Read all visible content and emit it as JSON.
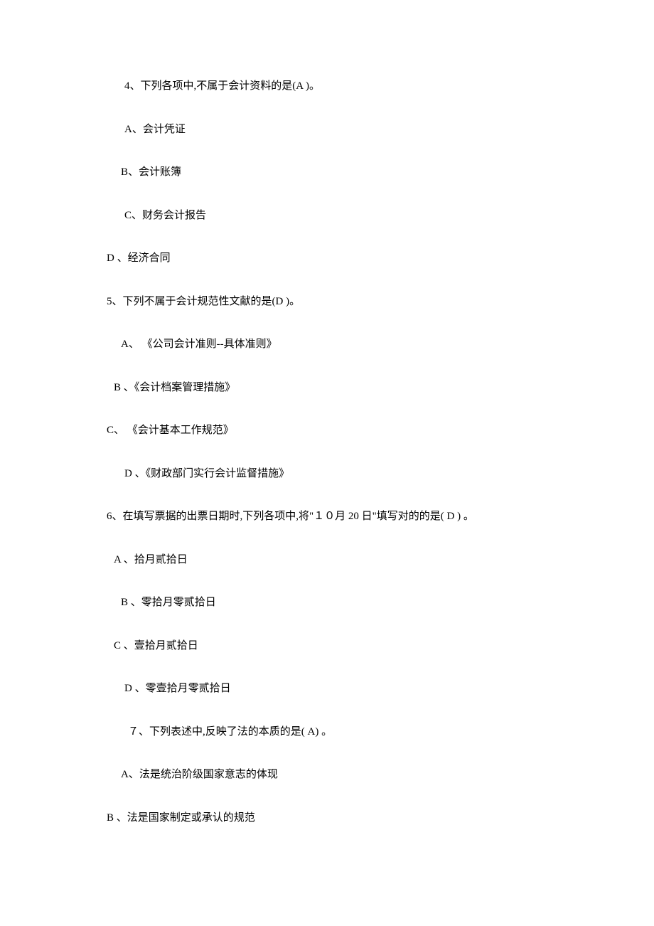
{
  "lines": [
    {
      "indent": "indent-3",
      "text": "4、下列各项中,不属于会计资料的是(A )。"
    },
    {
      "indent": "indent-3",
      "text": "A、会计凭证"
    },
    {
      "indent": "indent-2",
      "text": "B、会计账簿"
    },
    {
      "indent": "indent-3",
      "text": "C、财务会计报告"
    },
    {
      "indent": "indent-0",
      "text": "D 、经济合同"
    },
    {
      "indent": "indent-0",
      "text": "5、下列不属于会计规范性文献的是(D  )。"
    },
    {
      "indent": "indent-2",
      "text": "A、 《公司会计准则--具体准则》"
    },
    {
      "indent": "indent-1",
      "text": "B 、《会计档案管理措施》"
    },
    {
      "indent": "indent-0",
      "text": "C、 《会计基本工作规范》"
    },
    {
      "indent": "indent-3",
      "text": "D 、《财政部门实行会计监督措施》"
    },
    {
      "indent": "indent-0",
      "text": "6、在填写票据的出票日期时,下列各项中,将\"１０月 20 日\"填写对的的是(   D ) 。"
    },
    {
      "indent": "indent-1",
      "text": "A 、拾月贰拾日"
    },
    {
      "indent": "indent-2",
      "text": "B 、零拾月零贰拾日"
    },
    {
      "indent": "indent-1",
      "text": "C 、壹拾月贰拾日"
    },
    {
      "indent": "indent-3",
      "text": "D 、零壹拾月零贰拾日"
    },
    {
      "indent": "indent-4",
      "text": "７、下列表述中,反映了法的本质的是(  A) 。"
    },
    {
      "indent": "indent-2",
      "text": "A、法是统治阶级国家意志的体现"
    },
    {
      "indent": "indent-0",
      "text": "B 、法是国家制定或承认的规范"
    }
  ]
}
